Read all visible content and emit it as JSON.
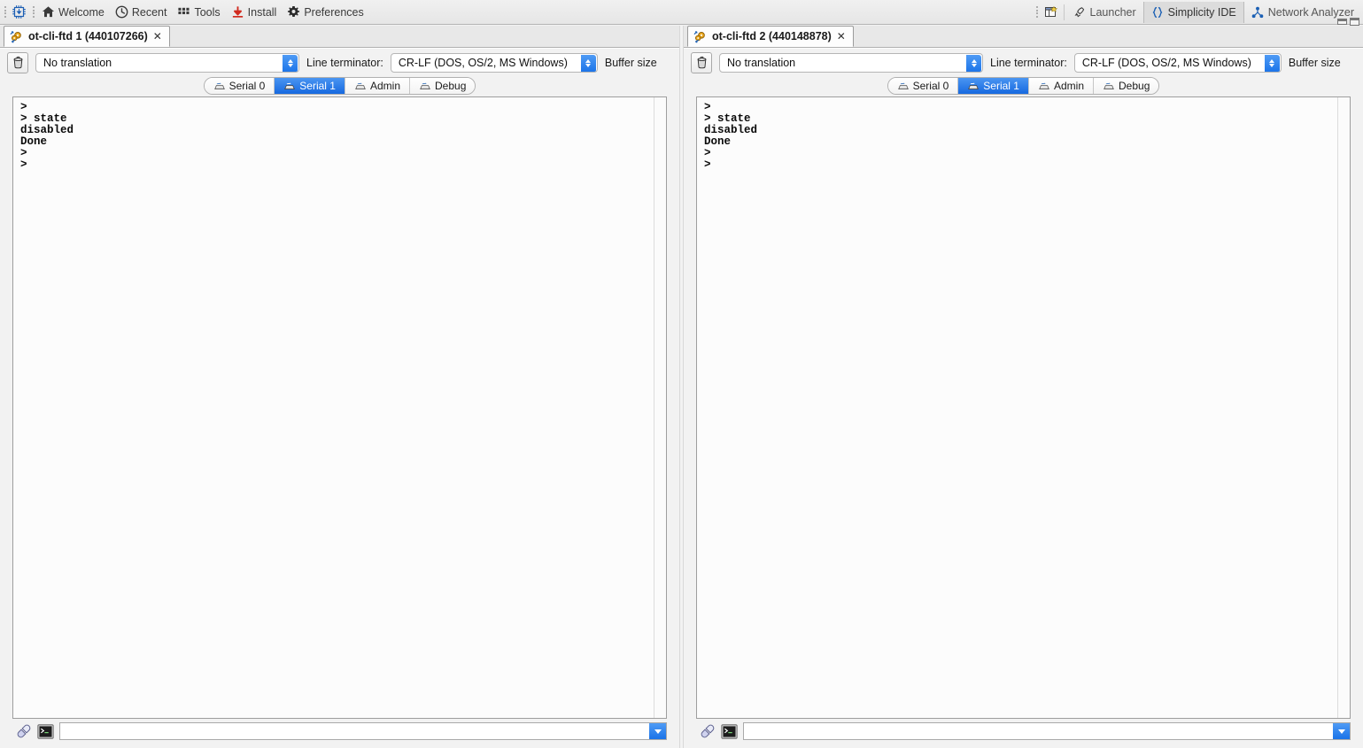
{
  "toolbar": {
    "chip_icon": "chip-flash-icon",
    "items": [
      {
        "label": "Welcome",
        "icon": "home-icon"
      },
      {
        "label": "Recent",
        "icon": "clock-icon"
      },
      {
        "label": "Tools",
        "icon": "grid-icon"
      },
      {
        "label": "Install",
        "icon": "download-icon"
      },
      {
        "label": "Preferences",
        "icon": "gear-icon"
      }
    ],
    "perspective_icon": "new-perspective-icon",
    "perspectives": [
      {
        "label": "Launcher",
        "icon": "rocket-icon",
        "active": false
      },
      {
        "label": "Simplicity IDE",
        "icon": "braces-icon",
        "active": true
      },
      {
        "label": "Network Analyzer",
        "icon": "network-icon",
        "active": false
      }
    ],
    "window_controls": [
      "minimize",
      "maximize"
    ]
  },
  "colors": {
    "accent_blue": "#1a73e8",
    "tab_active_blue": "#1769e0",
    "toolbar_bg": "#e6e6e6",
    "console_bg": "#fcfcfc",
    "install_icon_red": "#d12b1f"
  },
  "panes": [
    {
      "tab": {
        "title": "ot-cli-ftd 1 (440107266)",
        "icon": "serial-gears-icon",
        "close": "✕"
      },
      "clear_button_icon": "trash-icon",
      "translation": {
        "value": "No translation"
      },
      "line_terminator": {
        "label": "Line terminator:",
        "value": "CR-LF  (DOS, OS/2, MS Windows)"
      },
      "buffer_size_label": "Buffer size",
      "serial_tabs": [
        {
          "label": "Serial 0",
          "icon": "keyboard-icon",
          "active": false
        },
        {
          "label": "Serial 1",
          "icon": "keyboard-icon",
          "active": true
        },
        {
          "label": "Admin",
          "icon": "keyboard-icon",
          "active": false
        },
        {
          "label": "Debug",
          "icon": "keyboard-icon",
          "active": false
        }
      ],
      "console_text": ">\n> state\ndisabled\nDone\n>\n>",
      "input": {
        "value": "",
        "placeholder": "",
        "connect_icon": "plug-icon",
        "prompt_icon": "terminal-icon",
        "history_icon": "chevron-down-icon"
      }
    },
    {
      "tab": {
        "title": "ot-cli-ftd 2 (440148878)",
        "icon": "serial-gears-icon",
        "close": "✕"
      },
      "clear_button_icon": "trash-icon",
      "translation": {
        "value": "No translation"
      },
      "line_terminator": {
        "label": "Line terminator:",
        "value": "CR-LF  (DOS, OS/2, MS Windows)"
      },
      "buffer_size_label": "Buffer size",
      "serial_tabs": [
        {
          "label": "Serial 0",
          "icon": "keyboard-icon",
          "active": false
        },
        {
          "label": "Serial 1",
          "icon": "keyboard-icon",
          "active": true
        },
        {
          "label": "Admin",
          "icon": "keyboard-icon",
          "active": false
        },
        {
          "label": "Debug",
          "icon": "keyboard-icon",
          "active": false
        }
      ],
      "console_text": ">\n> state\ndisabled\nDone\n>\n>",
      "input": {
        "value": "",
        "placeholder": "",
        "connect_icon": "plug-icon",
        "prompt_icon": "terminal-icon",
        "history_icon": "chevron-down-icon"
      }
    }
  ]
}
